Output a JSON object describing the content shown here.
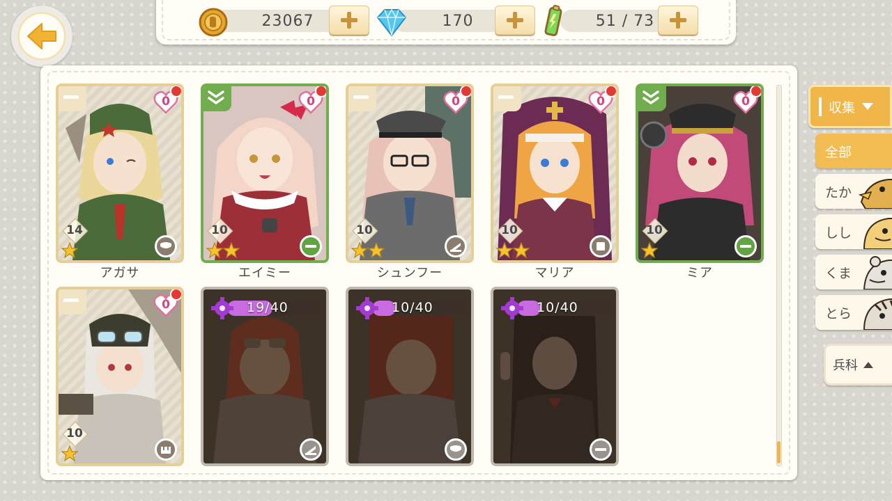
{
  "resources": {
    "coins": "23067",
    "gems": "170",
    "stamina": "51 / 73"
  },
  "cards": [
    {
      "name": "アガサ",
      "affection": "0",
      "level": "14",
      "stars": 1,
      "frame": "gold",
      "rarity_icon": "minus",
      "class_icon": "shield",
      "unlocked": true
    },
    {
      "name": "エイミー",
      "affection": "0",
      "level": "10",
      "stars": 2,
      "frame": "green",
      "rarity_icon": "double-chevron",
      "class_icon": "minus",
      "unlocked": true
    },
    {
      "name": "シュンフー",
      "affection": "0",
      "level": "10",
      "stars": 2,
      "frame": "gold",
      "rarity_icon": "minus",
      "class_icon": "angle",
      "unlocked": true
    },
    {
      "name": "マリア",
      "affection": "0",
      "level": "10",
      "stars": 2,
      "frame": "gold",
      "rarity_icon": "minus",
      "class_icon": "square",
      "unlocked": true
    },
    {
      "name": "ミア",
      "affection": "0",
      "level": "10",
      "stars": 1,
      "frame": "green",
      "rarity_icon": "double-chevron",
      "class_icon": "minus",
      "unlocked": true
    },
    {
      "name": "",
      "affection": "0",
      "level": "10",
      "stars": 1,
      "frame": "gold",
      "rarity_icon": "minus",
      "class_icon": "tower",
      "unlocked": true
    },
    {
      "name": "",
      "fragments": "19/40",
      "fragment_progress": 0.475,
      "class_icon": "angle",
      "unlocked": false
    },
    {
      "name": "",
      "fragments": "10/40",
      "fragment_progress": 0.25,
      "class_icon": "shield",
      "unlocked": false
    },
    {
      "name": "",
      "fragments": "10/40",
      "fragment_progress": 0.25,
      "class_icon": "minus",
      "unlocked": false
    }
  ],
  "filters": {
    "collect_label": "収集",
    "all_label": "全部",
    "taka_label": "たか",
    "shishi_label": "しし",
    "kuma_label": "くま",
    "tora_label": "とら",
    "branch_label": "兵科"
  },
  "colors": {
    "accent_orange": "#f1b64a",
    "frame_gold": "#e6cf97",
    "frame_green": "#71ad4e",
    "heart_pink": "#d2447e",
    "fragment_purple": "#c86ae0"
  },
  "icons": {
    "back": "arrow-left-icon",
    "coins": "coin-icon",
    "gems": "diamond-icon",
    "stamina": "battery-icon"
  }
}
